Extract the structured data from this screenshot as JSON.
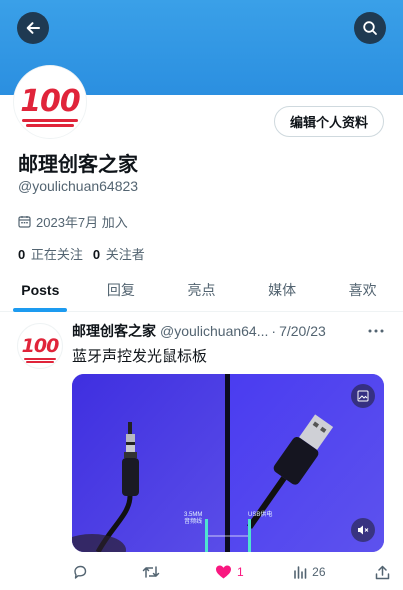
{
  "colors": {
    "banner": "#2b8fe0",
    "accent": "#1d9bf0",
    "like": "#f91880",
    "muted": "#536471"
  },
  "header": {
    "back_icon": "arrow-left-icon",
    "search_icon": "search-icon"
  },
  "profile": {
    "avatar_emoji": "100",
    "edit_button": "编辑个人资料",
    "display_name": "邮理创客之家",
    "handle": "@youlichuan64823",
    "joined_icon": "calendar-icon",
    "joined": "2023年7月 加入",
    "following_count": "0",
    "following_label": "正在关注",
    "followers_count": "0",
    "followers_label": "关注者"
  },
  "tabs": [
    {
      "label": "Posts",
      "active": true
    },
    {
      "label": "回复"
    },
    {
      "label": "亮点"
    },
    {
      "label": "媒体"
    },
    {
      "label": "喜欢"
    }
  ],
  "post": {
    "author": "邮理创客之家",
    "handle": "@youlichuan64...",
    "separator": "·",
    "date": "7/20/23",
    "text": "蓝牙声控发光鼠标板",
    "media": {
      "caption_left_1": "3.5MM",
      "caption_left_2": "音频线",
      "caption_right": "USB供电"
    },
    "actions": {
      "reply_count": "",
      "repost_count": "",
      "like_count": "1",
      "views_count": "26"
    }
  }
}
